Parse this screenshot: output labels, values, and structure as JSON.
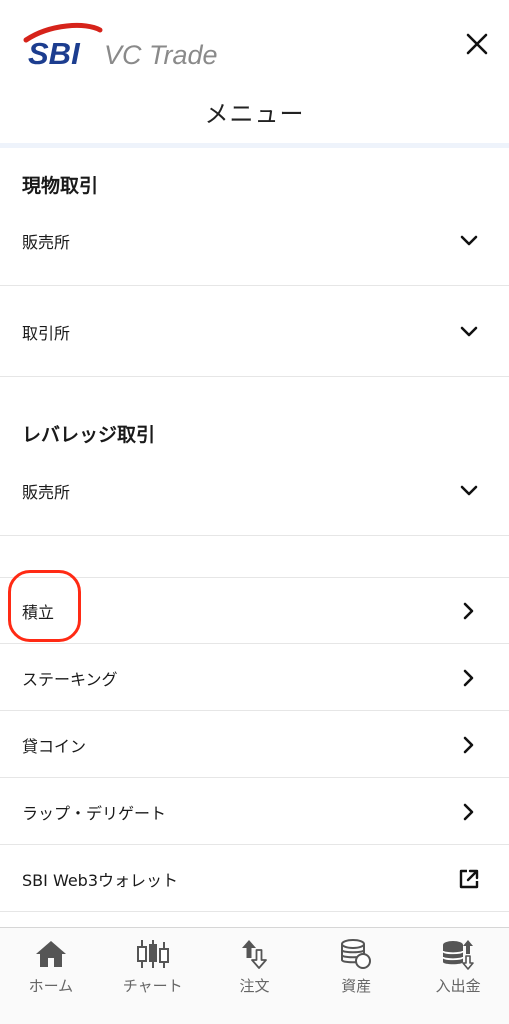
{
  "header": {
    "brand_primary": "SBI",
    "brand_secondary": "VC Trade",
    "title": "メニュー",
    "brand_color": "#1c3d8f",
    "accent_color": "#d6231a"
  },
  "sections": [
    {
      "heading": "現物取引",
      "items": [
        {
          "label": "販売所",
          "icon": "chevron-down-icon"
        },
        {
          "label": "取引所",
          "icon": "chevron-down-icon"
        }
      ]
    },
    {
      "heading": "レバレッジ取引",
      "items": [
        {
          "label": "販売所",
          "icon": "chevron-down-icon"
        }
      ]
    }
  ],
  "menu_items": [
    {
      "label": "積立",
      "icon": "chevron-right-icon",
      "highlighted": true
    },
    {
      "label": "ステーキング",
      "icon": "chevron-right-icon"
    },
    {
      "label": "貸コイン",
      "icon": "chevron-right-icon"
    },
    {
      "label": "ラップ・デリゲート",
      "icon": "chevron-right-icon"
    },
    {
      "label": "SBI Web3ウォレット",
      "icon": "external-link-icon"
    }
  ],
  "tabbar": [
    {
      "label": "ホーム",
      "icon": "home-icon"
    },
    {
      "label": "チャート",
      "icon": "candlestick-chart-icon"
    },
    {
      "label": "注文",
      "icon": "order-arrows-icon"
    },
    {
      "label": "資産",
      "icon": "coins-icon"
    },
    {
      "label": "入出金",
      "icon": "deposit-withdraw-icon"
    }
  ],
  "highlight_color": "#ff2a14"
}
